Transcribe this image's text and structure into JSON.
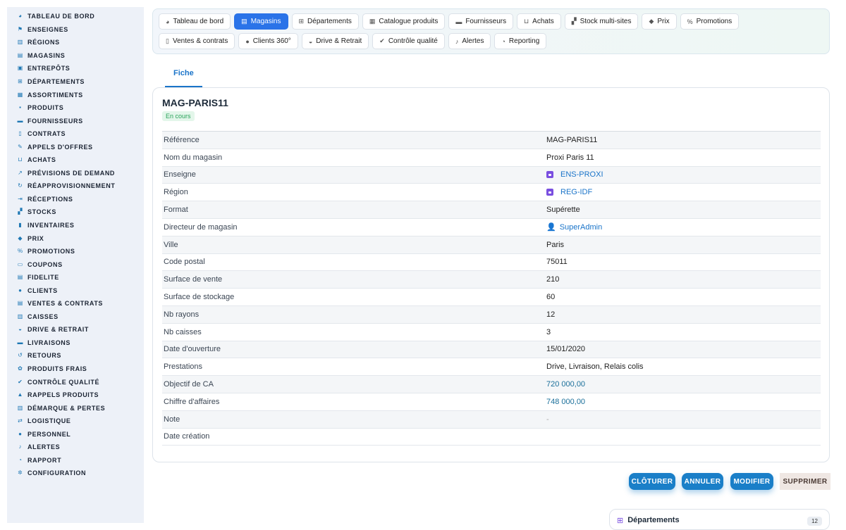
{
  "sidebar": {
    "items": [
      {
        "label": "TABLEAU DE BORD",
        "icon": "dashboard-icon",
        "glyph": "◕"
      },
      {
        "label": "ENSEIGNES",
        "icon": "flag-icon",
        "glyph": "⚑"
      },
      {
        "label": "RÉGIONS",
        "icon": "map-icon",
        "glyph": "▥"
      },
      {
        "label": "MAGASINS",
        "icon": "store-icon",
        "glyph": "▤"
      },
      {
        "label": "ENTREPÔTS",
        "icon": "warehouse-icon",
        "glyph": "▣"
      },
      {
        "label": "DÉPARTEMENTS",
        "icon": "basket-icon",
        "glyph": "⊞"
      },
      {
        "label": "ASSORTIMENTS",
        "icon": "layers-icon",
        "glyph": "▦"
      },
      {
        "label": "PRODUITS",
        "icon": "box-icon",
        "glyph": "▪"
      },
      {
        "label": "FOURNISSEURS",
        "icon": "truck-icon",
        "glyph": "▬"
      },
      {
        "label": "CONTRATS",
        "icon": "contract-icon",
        "glyph": "▯"
      },
      {
        "label": "APPELS D'OFFRES",
        "icon": "gavel-icon",
        "glyph": "✎"
      },
      {
        "label": "ACHATS",
        "icon": "cart-icon",
        "glyph": "⊔"
      },
      {
        "label": "PRÉVISIONS DE DEMAND",
        "icon": "chart-line-icon",
        "glyph": "↗"
      },
      {
        "label": "RÉAPPROVISIONNEMENT",
        "icon": "refresh-icon",
        "glyph": "↻"
      },
      {
        "label": "RÉCEPTIONS",
        "icon": "dolly-icon",
        "glyph": "⇥"
      },
      {
        "label": "STOCKS",
        "icon": "boxes-icon",
        "glyph": "▞"
      },
      {
        "label": "INVENTAIRES",
        "icon": "clipboard-icon",
        "glyph": "▮"
      },
      {
        "label": "PRIX",
        "icon": "tag-icon",
        "glyph": "◆"
      },
      {
        "label": "PROMOTIONS",
        "icon": "percent-icon",
        "glyph": "%"
      },
      {
        "label": "COUPONS",
        "icon": "ticket-icon",
        "glyph": "▭"
      },
      {
        "label": "FIDELITE",
        "icon": "card-icon",
        "glyph": "▤"
      },
      {
        "label": "CLIENTS",
        "icon": "user-icon",
        "glyph": "●"
      },
      {
        "label": "VENTES & CONTRATS",
        "icon": "sales-icon",
        "glyph": "▤"
      },
      {
        "label": "CAISSES",
        "icon": "register-icon",
        "glyph": "▥"
      },
      {
        "label": "DRIVE & RETRAIT",
        "icon": "car-icon",
        "glyph": "◒"
      },
      {
        "label": "LIVRAISONS",
        "icon": "delivery-icon",
        "glyph": "▬"
      },
      {
        "label": "RETOURS",
        "icon": "undo-icon",
        "glyph": "↺"
      },
      {
        "label": "PRODUITS FRAIS",
        "icon": "leaf-icon",
        "glyph": "✿"
      },
      {
        "label": "CONTRÔLE QUALITÉ",
        "icon": "check-double-icon",
        "glyph": "✔"
      },
      {
        "label": "RAPPELS PRODUITS",
        "icon": "warning-icon",
        "glyph": "▲"
      },
      {
        "label": "DÉMARQUE & PERTES",
        "icon": "trash-icon",
        "glyph": "▥"
      },
      {
        "label": "LOGISTIQUE",
        "icon": "route-icon",
        "glyph": "⇄"
      },
      {
        "label": "PERSONNEL",
        "icon": "users-icon",
        "glyph": "●"
      },
      {
        "label": "ALERTES",
        "icon": "bell-icon",
        "glyph": "♪"
      },
      {
        "label": "RAPPORT",
        "icon": "pie-icon",
        "glyph": "◔"
      },
      {
        "label": "CONFIGURATION",
        "icon": "cog-icon",
        "glyph": "✲"
      }
    ]
  },
  "topnav": {
    "row1": [
      {
        "label": "Tableau de bord",
        "icon": "dashboard-icon",
        "glyph": "◕",
        "active": false
      },
      {
        "label": "Magasins",
        "icon": "store-icon",
        "glyph": "▤",
        "active": true
      },
      {
        "label": "Départements",
        "icon": "basket-icon",
        "glyph": "⊞",
        "active": false
      },
      {
        "label": "Catalogue produits",
        "icon": "catalog-icon",
        "glyph": "▦",
        "active": false
      },
      {
        "label": "Fournisseurs",
        "icon": "truck-icon",
        "glyph": "▬",
        "active": false
      },
      {
        "label": "Achats",
        "icon": "cart-icon",
        "glyph": "⊔",
        "active": false
      },
      {
        "label": "Stock multi-sites",
        "icon": "boxes-icon",
        "glyph": "▞",
        "active": false
      },
      {
        "label": "Prix",
        "icon": "tag-icon",
        "glyph": "◆",
        "active": false
      },
      {
        "label": "Promotions",
        "icon": "percent-icon",
        "glyph": "%",
        "active": false
      }
    ],
    "row2": [
      {
        "label": "Ventes & contrats",
        "icon": "sales-icon",
        "glyph": "▯",
        "active": false
      },
      {
        "label": "Clients 360°",
        "icon": "user-icon",
        "glyph": "●",
        "active": false
      },
      {
        "label": "Drive & Retrait",
        "icon": "car-icon",
        "glyph": "◒",
        "active": false
      },
      {
        "label": "Contrôle qualité",
        "icon": "check-double-icon",
        "glyph": "✔",
        "active": false
      },
      {
        "label": "Alertes",
        "icon": "bell-icon",
        "glyph": "♪",
        "active": false
      },
      {
        "label": "Reporting",
        "icon": "pie-icon",
        "glyph": "◔",
        "active": false
      }
    ]
  },
  "tabs": {
    "fiche": "Fiche"
  },
  "record": {
    "title": "MAG-PARIS11",
    "status": "En cours",
    "fields": [
      {
        "key": "Référence",
        "value": "MAG-PARIS11",
        "type": "text"
      },
      {
        "key": "Nom du magasin",
        "value": "Proxi Paris 11",
        "type": "text"
      },
      {
        "key": "Enseigne",
        "value": "ENS-PROXI",
        "type": "ref"
      },
      {
        "key": "Région",
        "value": "REG-IDF",
        "type": "ref"
      },
      {
        "key": "Format",
        "value": "Supérette",
        "type": "text"
      },
      {
        "key": "Directeur de magasin",
        "value": "SuperAdmin",
        "type": "user"
      },
      {
        "key": "Ville",
        "value": "Paris",
        "type": "text"
      },
      {
        "key": "Code postal",
        "value": "75011",
        "type": "text"
      },
      {
        "key": "Surface de vente",
        "value": "210",
        "type": "text"
      },
      {
        "key": "Surface de stockage",
        "value": "60",
        "type": "text"
      },
      {
        "key": "Nb rayons",
        "value": "12",
        "type": "text"
      },
      {
        "key": "Nb caisses",
        "value": "3",
        "type": "text"
      },
      {
        "key": "Date d'ouverture",
        "value": "15/01/2020",
        "type": "text"
      },
      {
        "key": "Prestations",
        "value": "Drive, Livraison, Relais colis",
        "type": "text"
      },
      {
        "key": "Objectif de CA",
        "value": "720 000,00",
        "type": "num"
      },
      {
        "key": "Chiffre d'affaires",
        "value": "748 000,00",
        "type": "num"
      },
      {
        "key": "Note",
        "value": "-",
        "type": "muted"
      },
      {
        "key": "Date création",
        "value": "",
        "type": "text"
      }
    ]
  },
  "actions": {
    "close": "CLÔTURER",
    "cancel": "ANNULER",
    "edit": "MODIFIER",
    "delete": "SUPPRIMER"
  },
  "related": {
    "title": "Départements",
    "count": "12"
  }
}
